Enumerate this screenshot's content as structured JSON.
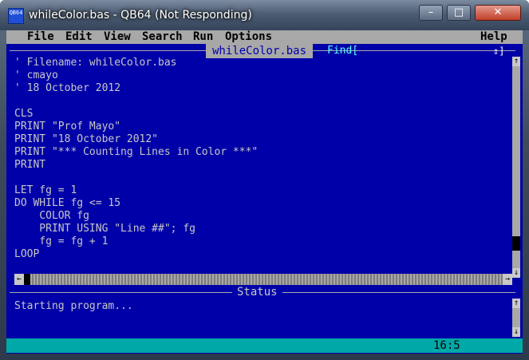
{
  "window": {
    "title": "whileColor.bas - QB64 (Not Responding)",
    "icon_text": "QB64",
    "controls": {
      "minimize": "–",
      "maximize": "□",
      "close": "✕"
    }
  },
  "menu": {
    "items": [
      "File",
      "Edit",
      "View",
      "Search",
      "Run",
      "Options"
    ],
    "help": "Help"
  },
  "editor": {
    "filename_tab": "whileColor.bas",
    "find_label": "Find[",
    "find_arrows": "⇕]",
    "lines": [
      "' Filename: whileColor.bas",
      "' cmayo",
      "' 18 October 2012",
      "",
      "CLS",
      "PRINT \"Prof Mayo\"",
      "PRINT \"18 October 2012\"",
      "PRINT \"*** Counting Lines in Color ***\"",
      "PRINT",
      "",
      "LET fg = 1",
      "DO WHILE fg <= 15",
      "    COLOR fg",
      "    PRINT USING \"Line ##\"; fg",
      "    fg = fg + 1",
      "LOOP"
    ]
  },
  "status": {
    "title": "Status",
    "text": "Starting program..."
  },
  "cursor_position": "16:5",
  "colors": {
    "editor_background": "#0000A8",
    "editor_text": "#C8C8C8",
    "menubar": "#A8A8A8",
    "bottombar": "#00A8A8"
  }
}
